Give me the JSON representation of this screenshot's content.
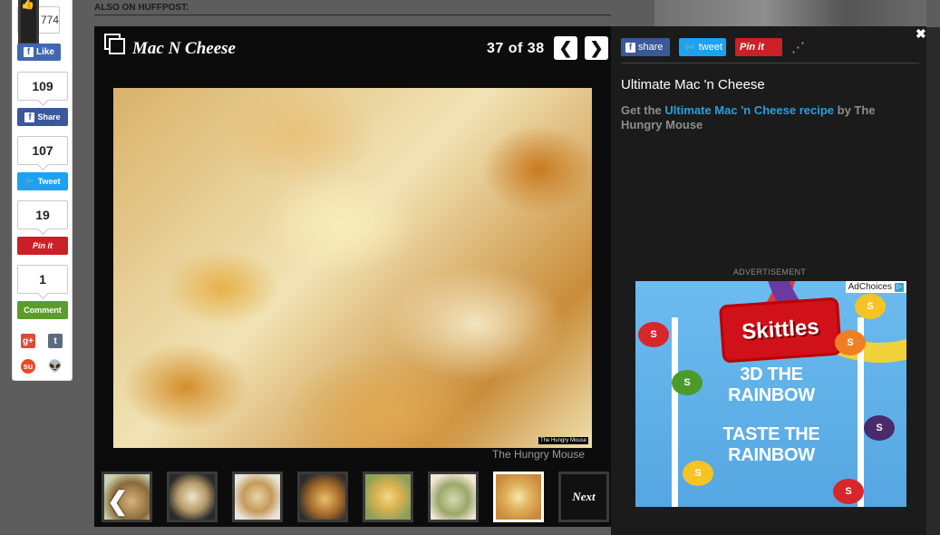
{
  "page": {
    "also_on_label": "ALSO ON HUFFPOST:"
  },
  "share_rail": {
    "like_count": "774",
    "like_label": "Like",
    "facebook_count": "109",
    "facebook_label": "Share",
    "twitter_count": "107",
    "twitter_label": "Tweet",
    "pinterest_count": "19",
    "pinterest_label": "Pin it",
    "comment_count": "1",
    "comment_label": "Comment",
    "gplus_glyph": "g+",
    "tumblr_glyph": "t",
    "stumble_glyph": "su",
    "reddit_glyph": "👽",
    "colors": {
      "facebook": "#3b5998",
      "twitter": "#1da1f2",
      "pinterest": "#cb2027",
      "comment": "#5a9e2a"
    }
  },
  "slideshow": {
    "title": "Mac N Cheese",
    "counter": "37  of  38",
    "prev_glyph": "❮",
    "next_glyph": "❯",
    "photo_tag": "The Hungry Mouse",
    "photo_credit": "The Hungry Mouse",
    "thumb_arrow": "❮",
    "next_label": "Next"
  },
  "slide_info": {
    "close_glyph": "✖",
    "share_facebook": "share",
    "share_twitter": "tweet",
    "share_pinterest": "Pin it",
    "title": "Ultimate Mac 'n Cheese",
    "desc_prefix": "Get the ",
    "desc_link": "Ultimate Mac 'n Cheese recipe",
    "desc_suffix": " by The Hungry Mouse",
    "link_color": "#2d9ddc"
  },
  "advertisement": {
    "label": "ADVERTISEMENT",
    "adchoices": "AdChoices",
    "brand": "Skittles",
    "line1": "3D THE",
    "line2": "RAINBOW",
    "line3": "TASTE THE",
    "line4": "RAINBOW",
    "candy_letter": "S"
  }
}
